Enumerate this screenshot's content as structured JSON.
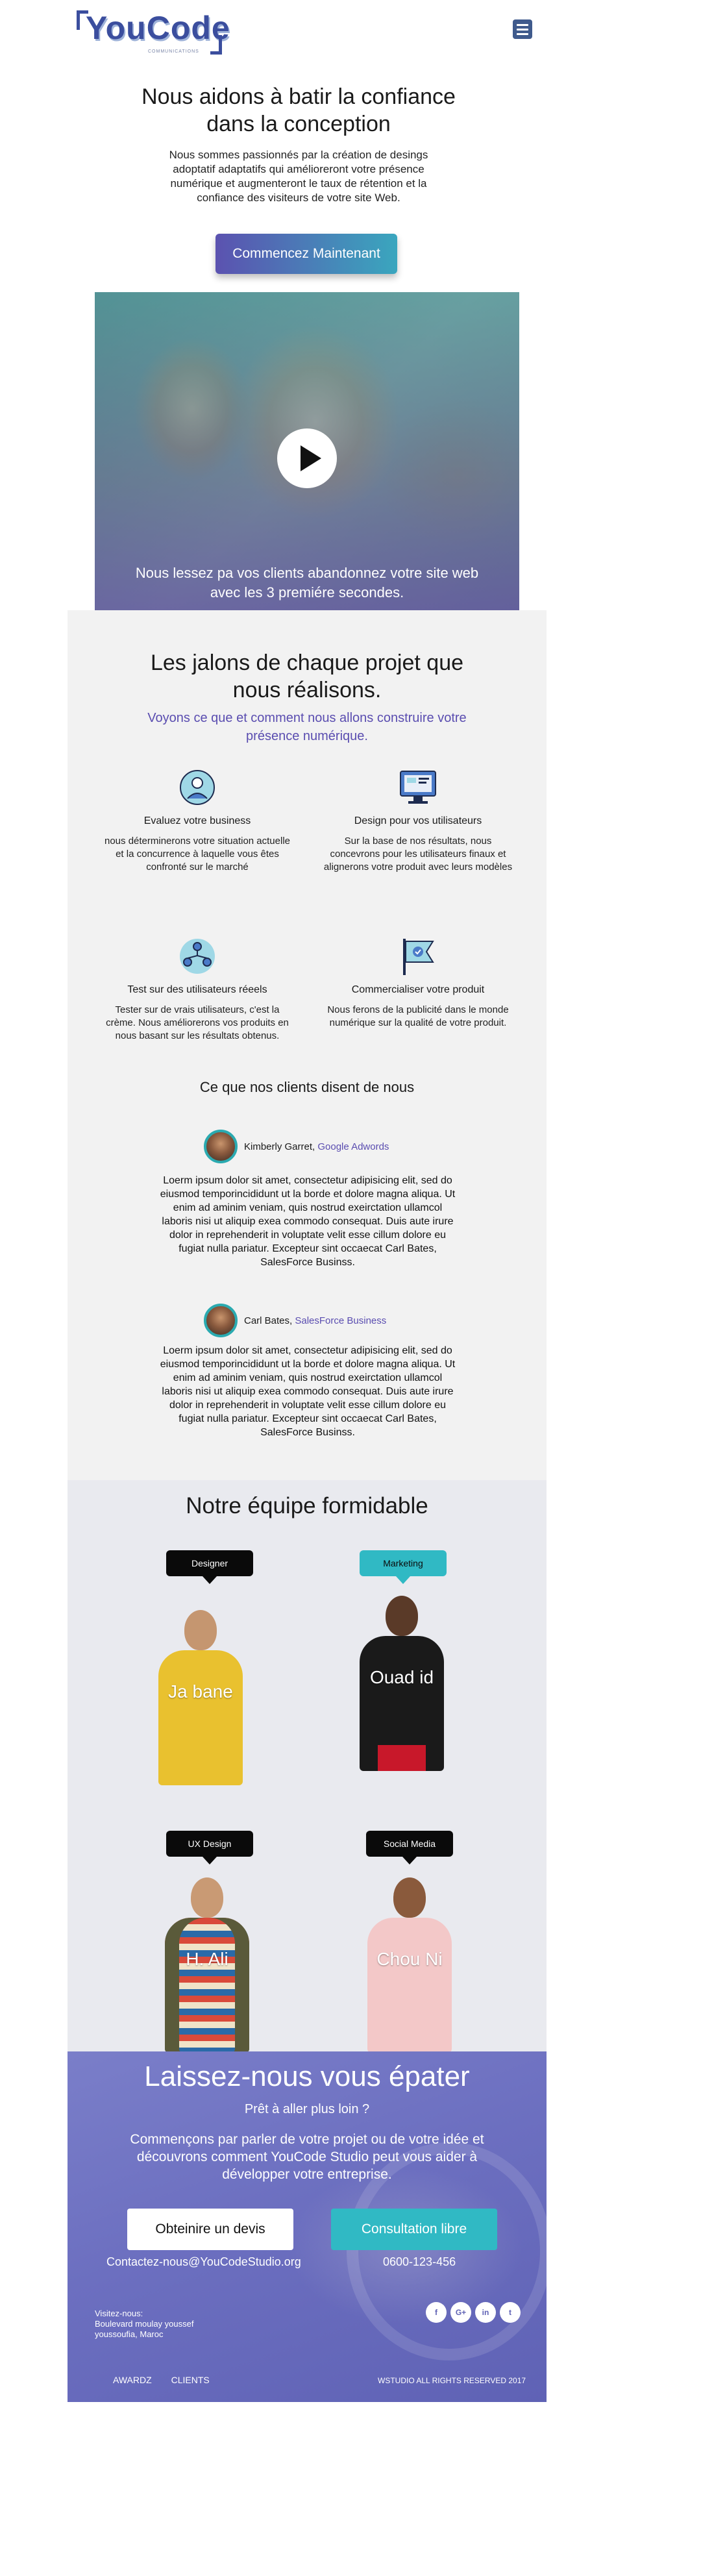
{
  "header": {
    "logo_text": "YouCode",
    "logo_sub": "COMMUNICATIONS",
    "menu_icon": "hamburger-menu-icon"
  },
  "hero": {
    "title": "Nous aidons à batir la confiance dans la conception",
    "text": "Nous sommes passionnés par la création de desings adoptatif adaptatifs qui amélioreront votre présence numérique et augmenteront le taux de rétention et la confiance des visiteurs de votre site Web.",
    "cta_label": "Commencez Maintenant",
    "video_caption": "Nous lessez pa vos clients abandonnez votre site web avec les 3 premiére secondes."
  },
  "milestones": {
    "title": "Les jalons de chaque projet que nous réalisons.",
    "subtitle": "Voyons ce que et comment nous allons construire votre présence numérique.",
    "features": [
      {
        "icon": "globe-person-icon",
        "title": "Evaluez votre business",
        "text": "nous déterminerons votre situation actuelle et la concurrence à laquelle vous êtes confronté sur le marché"
      },
      {
        "icon": "monitor-design-icon",
        "title": "Design pour vos utilisateurs",
        "text": "Sur la base de nos résultats, nous concevrons pour les utilisateurs finaux et alignerons votre produit avec leurs modèles"
      },
      {
        "icon": "users-network-icon",
        "title": "Test sur des utilisateurs réeels",
        "text": "Tester sur de vrais utilisateurs, c'est la crème. Nous améliorerons vos produits en nous basant sur les résultats obtenus."
      },
      {
        "icon": "flag-check-icon",
        "title": "Commercialiser votre produit",
        "text": "Nous ferons de la publicité dans le monde numérique sur la qualité de votre produit."
      }
    ]
  },
  "testimonials": {
    "title": "Ce que nos  clients  disent de nous",
    "items": [
      {
        "name": "Kimberly Garret, ",
        "company": "Google Adwords",
        "text": "Loerm ipsum dolor sit amet, consectetur adipisicing elit, sed do eiusmod temporincididunt ut la borde et dolore magna aliqua. Ut enim ad aminim veniam, quis nostrud exeirctation ullamcol laboris nisi ut aliquip exea commodo consequat. Duis aute irure dolor in reprehenderit in voluptate velit esse cillum dolore eu fugiat nulla pariatur. Excepteur sint occaecat Carl Bates, SalesForce Businss."
      },
      {
        "name": "Carl Bates, ",
        "company": "SalesForce Business",
        "text": "Loerm ipsum dolor sit amet, consectetur adipisicing elit, sed do eiusmod temporincididunt ut la borde et dolore magna aliqua. Ut enim ad aminim veniam, quis nostrud exeirctation ullamcol laboris nisi ut aliquip exea commodo consequat. Duis aute irure dolor in reprehenderit in voluptate velit esse cillum dolore eu fugiat nulla pariatur. Excepteur sint occaecat Carl Bates, SalesForce Businss."
      }
    ]
  },
  "team": {
    "title": "Notre équipe formidable",
    "members": [
      {
        "role": "Designer",
        "name": "Ja bane"
      },
      {
        "role": "Marketing",
        "name": "Ouad id"
      },
      {
        "role": "UX Design",
        "name": "H. Ali"
      },
      {
        "role": "Social Media",
        "name": "Chou Ni"
      }
    ]
  },
  "footer": {
    "title": "Laissez-nous vous épater",
    "subtitle": "Prêt à aller plus loin ?",
    "text": "Commençons par parler de votre projet ou de votre idée et découvrons comment YouCode Studio peut vous aider à développer votre entreprise.",
    "quote_label": "Obteinire un devis",
    "consult_label": "Consultation libre",
    "email": "Contactez-nous@YouCodeStudio.org",
    "phone": "0600-123-456",
    "visit_label": "Visitez-nous:",
    "address": "Boulevard moulay youssef youssoufia, Maroc",
    "socials": [
      "f",
      "G+",
      "in",
      "t"
    ],
    "links": [
      "AWARDZ",
      "CLIENTS"
    ],
    "rights": "WSTUDIO ALL RIGHTS RESERVED 2017"
  },
  "colors": {
    "brand": "#3b4e9e",
    "accent_purple": "#5a4db0",
    "accent_teal": "#30b9c4"
  }
}
